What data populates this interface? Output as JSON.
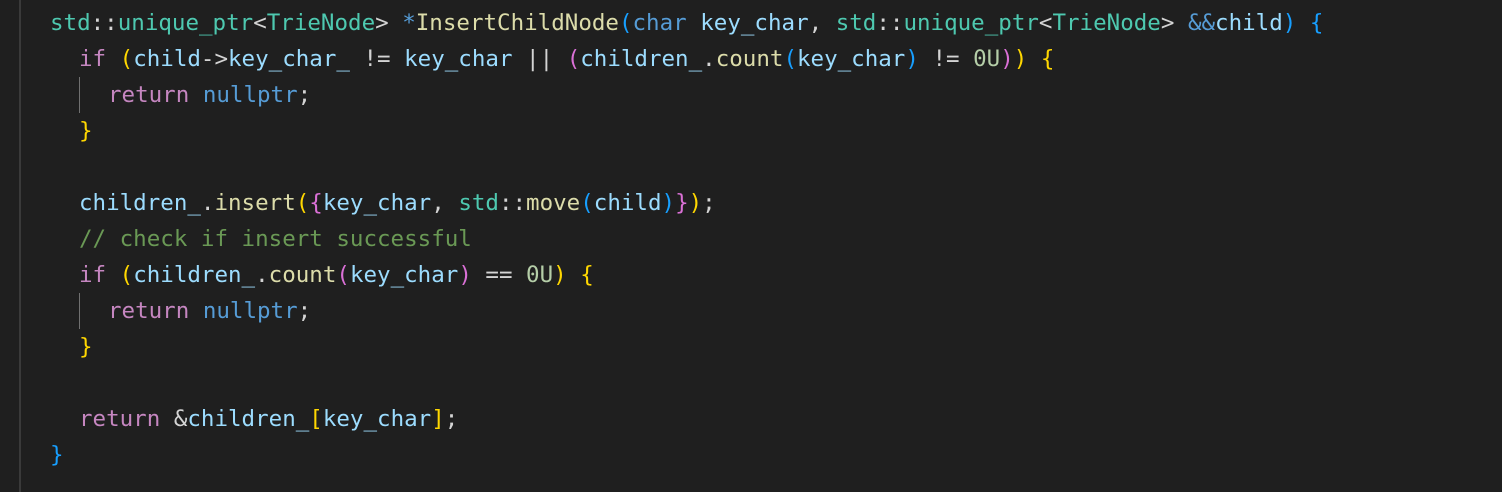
{
  "editor": {
    "language": "cpp",
    "colors": {
      "background": "#1f1f1f",
      "namespace_type": "#4ec9b0",
      "keyword": "#569cd6",
      "control": "#c586c0",
      "function": "#dcdcaa",
      "variable": "#9cdcfe",
      "number": "#b5cea8",
      "comment": "#6a9955",
      "bracket_level1": "#ffd700",
      "bracket_level2": "#da70d6",
      "bracket_level3": "#179fff"
    },
    "lines": [
      {
        "indent": 0,
        "tokens": [
          {
            "t": "std",
            "c": "ns"
          },
          {
            "t": "::",
            "c": "plain"
          },
          {
            "t": "unique_ptr",
            "c": "type"
          },
          {
            "t": "<",
            "c": "plain"
          },
          {
            "t": "TrieNode",
            "c": "type"
          },
          {
            "t": "> ",
            "c": "plain"
          },
          {
            "t": "*",
            "c": "kw"
          },
          {
            "t": "InsertChildNode",
            "c": "fn"
          },
          {
            "t": "(",
            "c": "b3"
          },
          {
            "t": "char",
            "c": "kw"
          },
          {
            "t": " ",
            "c": "plain"
          },
          {
            "t": "key_char",
            "c": "var"
          },
          {
            "t": ", ",
            "c": "plain"
          },
          {
            "t": "std",
            "c": "ns"
          },
          {
            "t": "::",
            "c": "plain"
          },
          {
            "t": "unique_ptr",
            "c": "type"
          },
          {
            "t": "<",
            "c": "plain"
          },
          {
            "t": "TrieNode",
            "c": "type"
          },
          {
            "t": "> ",
            "c": "plain"
          },
          {
            "t": "&&",
            "c": "kw"
          },
          {
            "t": "child",
            "c": "var"
          },
          {
            "t": ")",
            "c": "b3"
          },
          {
            "t": " ",
            "c": "plain"
          },
          {
            "t": "{",
            "c": "b3"
          }
        ]
      },
      {
        "indent": 1,
        "tokens": [
          {
            "t": "if",
            "c": "ctrl"
          },
          {
            "t": " ",
            "c": "plain"
          },
          {
            "t": "(",
            "c": "b1"
          },
          {
            "t": "child",
            "c": "var"
          },
          {
            "t": "->",
            "c": "plain"
          },
          {
            "t": "key_char_",
            "c": "var"
          },
          {
            "t": " != ",
            "c": "plain"
          },
          {
            "t": "key_char",
            "c": "var"
          },
          {
            "t": " || ",
            "c": "plain"
          },
          {
            "t": "(",
            "c": "b2"
          },
          {
            "t": "children_",
            "c": "var"
          },
          {
            "t": ".",
            "c": "plain"
          },
          {
            "t": "count",
            "c": "fn"
          },
          {
            "t": "(",
            "c": "b3"
          },
          {
            "t": "key_char",
            "c": "var"
          },
          {
            "t": ")",
            "c": "b3"
          },
          {
            "t": " != ",
            "c": "plain"
          },
          {
            "t": "0U",
            "c": "num"
          },
          {
            "t": ")",
            "c": "b2"
          },
          {
            "t": ")",
            "c": "b1"
          },
          {
            "t": " ",
            "c": "plain"
          },
          {
            "t": "{",
            "c": "b1"
          }
        ]
      },
      {
        "indent": 2,
        "tokens": [
          {
            "t": "return",
            "c": "ctrl"
          },
          {
            "t": " ",
            "c": "plain"
          },
          {
            "t": "nullptr",
            "c": "kw"
          },
          {
            "t": ";",
            "c": "plain"
          }
        ]
      },
      {
        "indent": 1,
        "tokens": [
          {
            "t": "}",
            "c": "b1"
          }
        ]
      },
      {
        "indent": 1,
        "tokens": []
      },
      {
        "indent": 1,
        "tokens": [
          {
            "t": "children_",
            "c": "var"
          },
          {
            "t": ".",
            "c": "plain"
          },
          {
            "t": "insert",
            "c": "fn"
          },
          {
            "t": "(",
            "c": "b1"
          },
          {
            "t": "{",
            "c": "b2"
          },
          {
            "t": "key_char",
            "c": "var"
          },
          {
            "t": ", ",
            "c": "plain"
          },
          {
            "t": "std",
            "c": "ns"
          },
          {
            "t": "::",
            "c": "plain"
          },
          {
            "t": "move",
            "c": "fn"
          },
          {
            "t": "(",
            "c": "b3"
          },
          {
            "t": "child",
            "c": "var"
          },
          {
            "t": ")",
            "c": "b3"
          },
          {
            "t": "}",
            "c": "b2"
          },
          {
            "t": ")",
            "c": "b1"
          },
          {
            "t": ";",
            "c": "plain"
          }
        ]
      },
      {
        "indent": 1,
        "tokens": [
          {
            "t": "// check if insert successful",
            "c": "cmt"
          }
        ]
      },
      {
        "indent": 1,
        "tokens": [
          {
            "t": "if",
            "c": "ctrl"
          },
          {
            "t": " ",
            "c": "plain"
          },
          {
            "t": "(",
            "c": "b1"
          },
          {
            "t": "children_",
            "c": "var"
          },
          {
            "t": ".",
            "c": "plain"
          },
          {
            "t": "count",
            "c": "fn"
          },
          {
            "t": "(",
            "c": "b2"
          },
          {
            "t": "key_char",
            "c": "var"
          },
          {
            "t": ")",
            "c": "b2"
          },
          {
            "t": " == ",
            "c": "plain"
          },
          {
            "t": "0U",
            "c": "num"
          },
          {
            "t": ")",
            "c": "b1"
          },
          {
            "t": " ",
            "c": "plain"
          },
          {
            "t": "{",
            "c": "b1"
          }
        ]
      },
      {
        "indent": 2,
        "tokens": [
          {
            "t": "return",
            "c": "ctrl"
          },
          {
            "t": " ",
            "c": "plain"
          },
          {
            "t": "nullptr",
            "c": "kw"
          },
          {
            "t": ";",
            "c": "plain"
          }
        ]
      },
      {
        "indent": 1,
        "tokens": [
          {
            "t": "}",
            "c": "b1"
          }
        ]
      },
      {
        "indent": 1,
        "tokens": []
      },
      {
        "indent": 1,
        "tokens": [
          {
            "t": "return",
            "c": "ctrl"
          },
          {
            "t": " ",
            "c": "plain"
          },
          {
            "t": "&",
            "c": "plain"
          },
          {
            "t": "children_",
            "c": "var"
          },
          {
            "t": "[",
            "c": "b1"
          },
          {
            "t": "key_char",
            "c": "var"
          },
          {
            "t": "]",
            "c": "b1"
          },
          {
            "t": ";",
            "c": "plain"
          }
        ]
      },
      {
        "indent": 0,
        "tokens": [
          {
            "t": "}",
            "c": "b3"
          }
        ]
      }
    ]
  }
}
